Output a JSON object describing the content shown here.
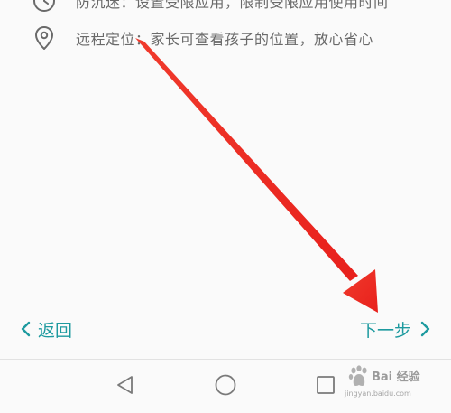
{
  "features": [
    {
      "icon": "clock-icon",
      "text": "防沉迷：设置受限应用，限制受限应用使用时间"
    },
    {
      "icon": "location-pin-icon",
      "text": "远程定位：家长可查看孩子的位置，放心省心"
    }
  ],
  "navigation": {
    "back_label": "返回",
    "next_label": "下一步"
  },
  "colors": {
    "accent": "#1d9a9f",
    "annotation_arrow": "#ee2a24",
    "body_text": "#6a6a6a"
  },
  "watermark": {
    "title": "Bai 经验",
    "url": "jingyan.baidu.com"
  }
}
